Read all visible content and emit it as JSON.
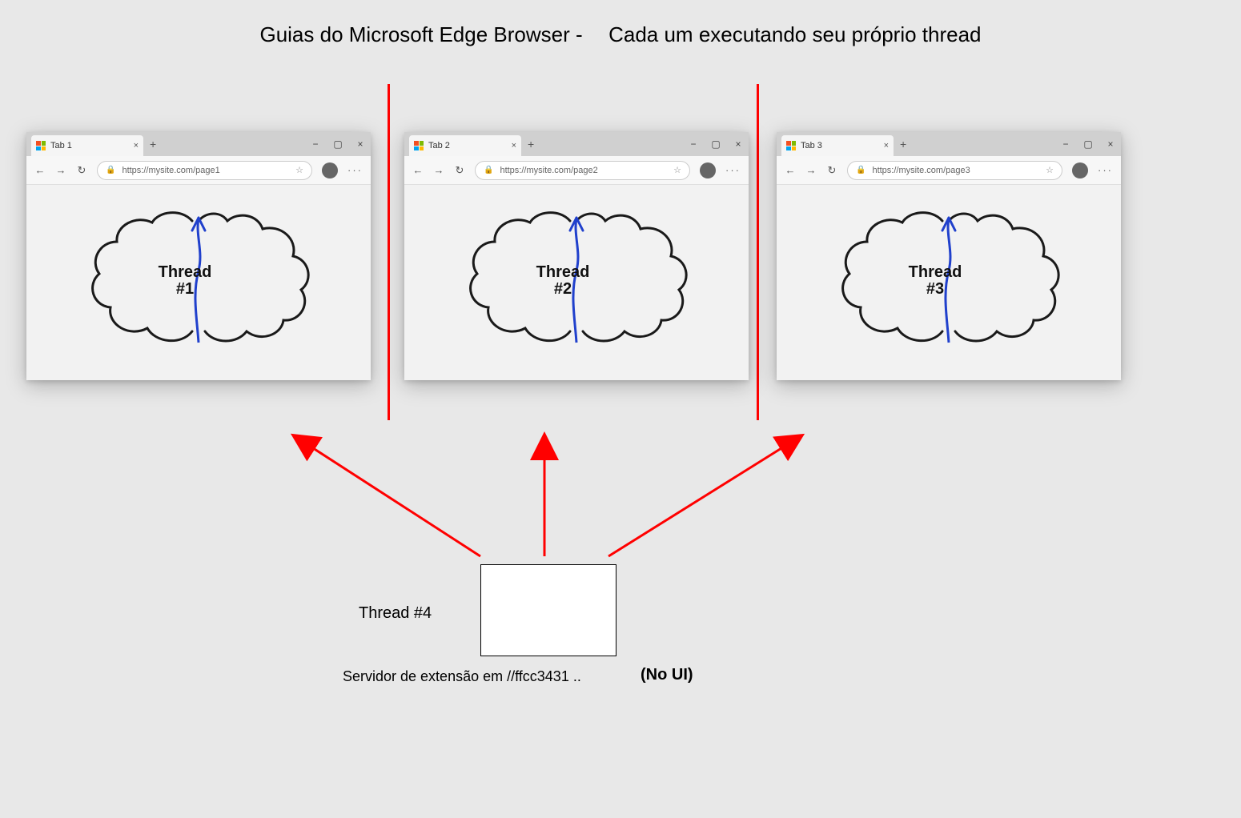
{
  "title": {
    "part1": "Guias do Microsoft Edge Browser -",
    "part2": "Cada um executando seu próprio thread"
  },
  "windows": [
    {
      "tab_label": "Tab 1",
      "url": "https://mysite.com/page1",
      "thread_label": "Thread\n#1"
    },
    {
      "tab_label": "Tab 2",
      "url": "https://mysite.com/page2",
      "thread_label": "Thread\n#2"
    },
    {
      "tab_label": "Tab 3",
      "url": "https://mysite.com/page3",
      "thread_label": "Thread\n#3"
    }
  ],
  "thread4_label": "Thread #4",
  "extension_caption": "Servidor de extensão em //ffcc3431 ..",
  "no_ui_label": "(No UI)"
}
